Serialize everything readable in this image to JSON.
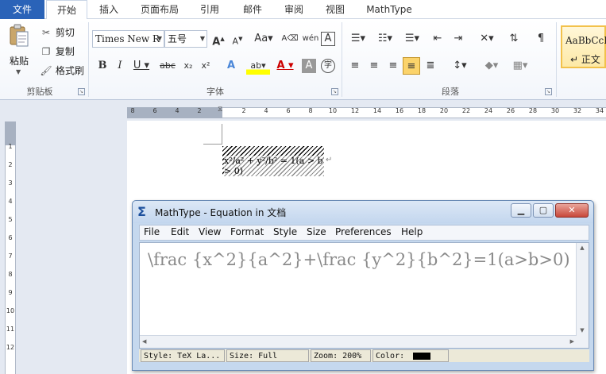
{
  "ribbon": {
    "tabs": [
      {
        "label": "文件"
      },
      {
        "label": "开始"
      },
      {
        "label": "插入"
      },
      {
        "label": "页面布局"
      },
      {
        "label": "引用"
      },
      {
        "label": "邮件"
      },
      {
        "label": "审阅"
      },
      {
        "label": "视图"
      },
      {
        "label": "MathType"
      }
    ],
    "clipboard": {
      "paste": "粘贴",
      "cut": "剪切",
      "copy": "复制",
      "format_painter": "格式刷",
      "group_label": "剪贴板"
    },
    "font": {
      "font_name": "Times New R",
      "font_size": "五号",
      "group_label": "字体"
    },
    "paragraph": {
      "group_label": "段落"
    },
    "styles": {
      "sample": "AaBbCcI",
      "name": "↵ 正文"
    }
  },
  "ruler": {
    "numbers": [
      "8",
      "6",
      "4",
      "2",
      "2",
      "4",
      "6",
      "8",
      "10",
      "12",
      "14",
      "16",
      "18",
      "20",
      "22",
      "24",
      "26",
      "28",
      "30",
      "32",
      "34"
    ],
    "vertical_numbers": [
      "1",
      "2",
      "3",
      "4",
      "5",
      "6",
      "7",
      "8",
      "9",
      "10",
      "11",
      "12"
    ]
  },
  "document": {
    "equation_text": "x²/a² + y²/b² = 1(a > b > 0)",
    "paragraph_mark": "↵"
  },
  "mathtype": {
    "title": "MathType - Equation in 文档",
    "menu": [
      "File",
      "Edit",
      "View",
      "Format",
      "Style",
      "Size",
      "Preferences",
      "Help"
    ],
    "content": "\\frac {x^2}{a^2}+\\frac {y^2}{b^2}=1(a>b>0)",
    "status": {
      "style": "Style: TeX La...",
      "size": "Size: Full",
      "zoom": "Zoom: 200%",
      "color": "Color:"
    },
    "color_value": "#000000"
  }
}
